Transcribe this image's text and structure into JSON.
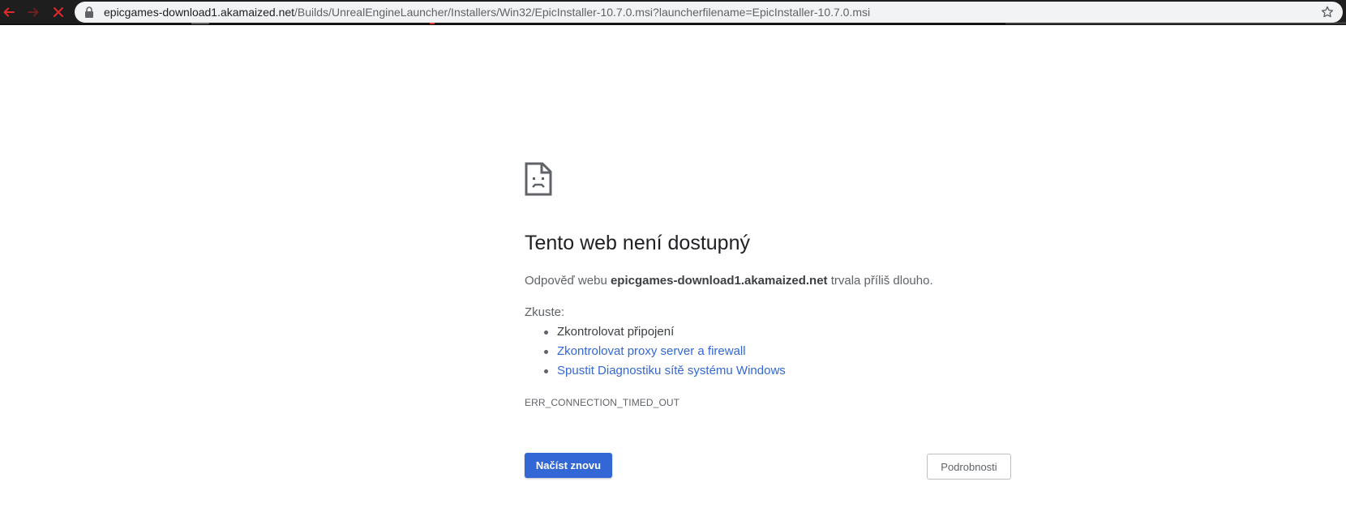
{
  "browser": {
    "url_domain": "epicgames-download1.akamaized.net",
    "url_path": "/Builds/UnrealEngineLauncher/Installers/Win32/EpicInstaller-10.7.0.msi?launcherfilename=EpicInstaller-10.7.0.msi",
    "icons": {
      "back": "back-arrow-icon",
      "forward": "forward-arrow-icon",
      "stop": "close-icon",
      "lock": "lock-icon",
      "bookmark": "star-icon"
    },
    "colors": {
      "toolbar": "#1e1e1e",
      "omnibox": "#f1f3f4",
      "stop_icon": "#e0292b"
    }
  },
  "error_page": {
    "icon": "sad-document-icon",
    "heading": "Tento web není dostupný",
    "desc_prefix": "Odpověď webu ",
    "desc_host": "epicgames-download1.akamaized.net",
    "desc_suffix": " trvala příliš dlouho.",
    "try_label": "Zkuste:",
    "suggestions": [
      "Zkontrolovat připojení",
      "Zkontrolovat proxy server a firewall",
      "Spustit Diagnostiku sítě systému Windows"
    ],
    "error_code": "ERR_CONNECTION_TIMED_OUT",
    "reload_label": "Načíst znovu",
    "details_label": "Podrobnosti",
    "colors": {
      "accent": "#3367d6",
      "heading": "#202124",
      "text": "#5f6368"
    }
  }
}
